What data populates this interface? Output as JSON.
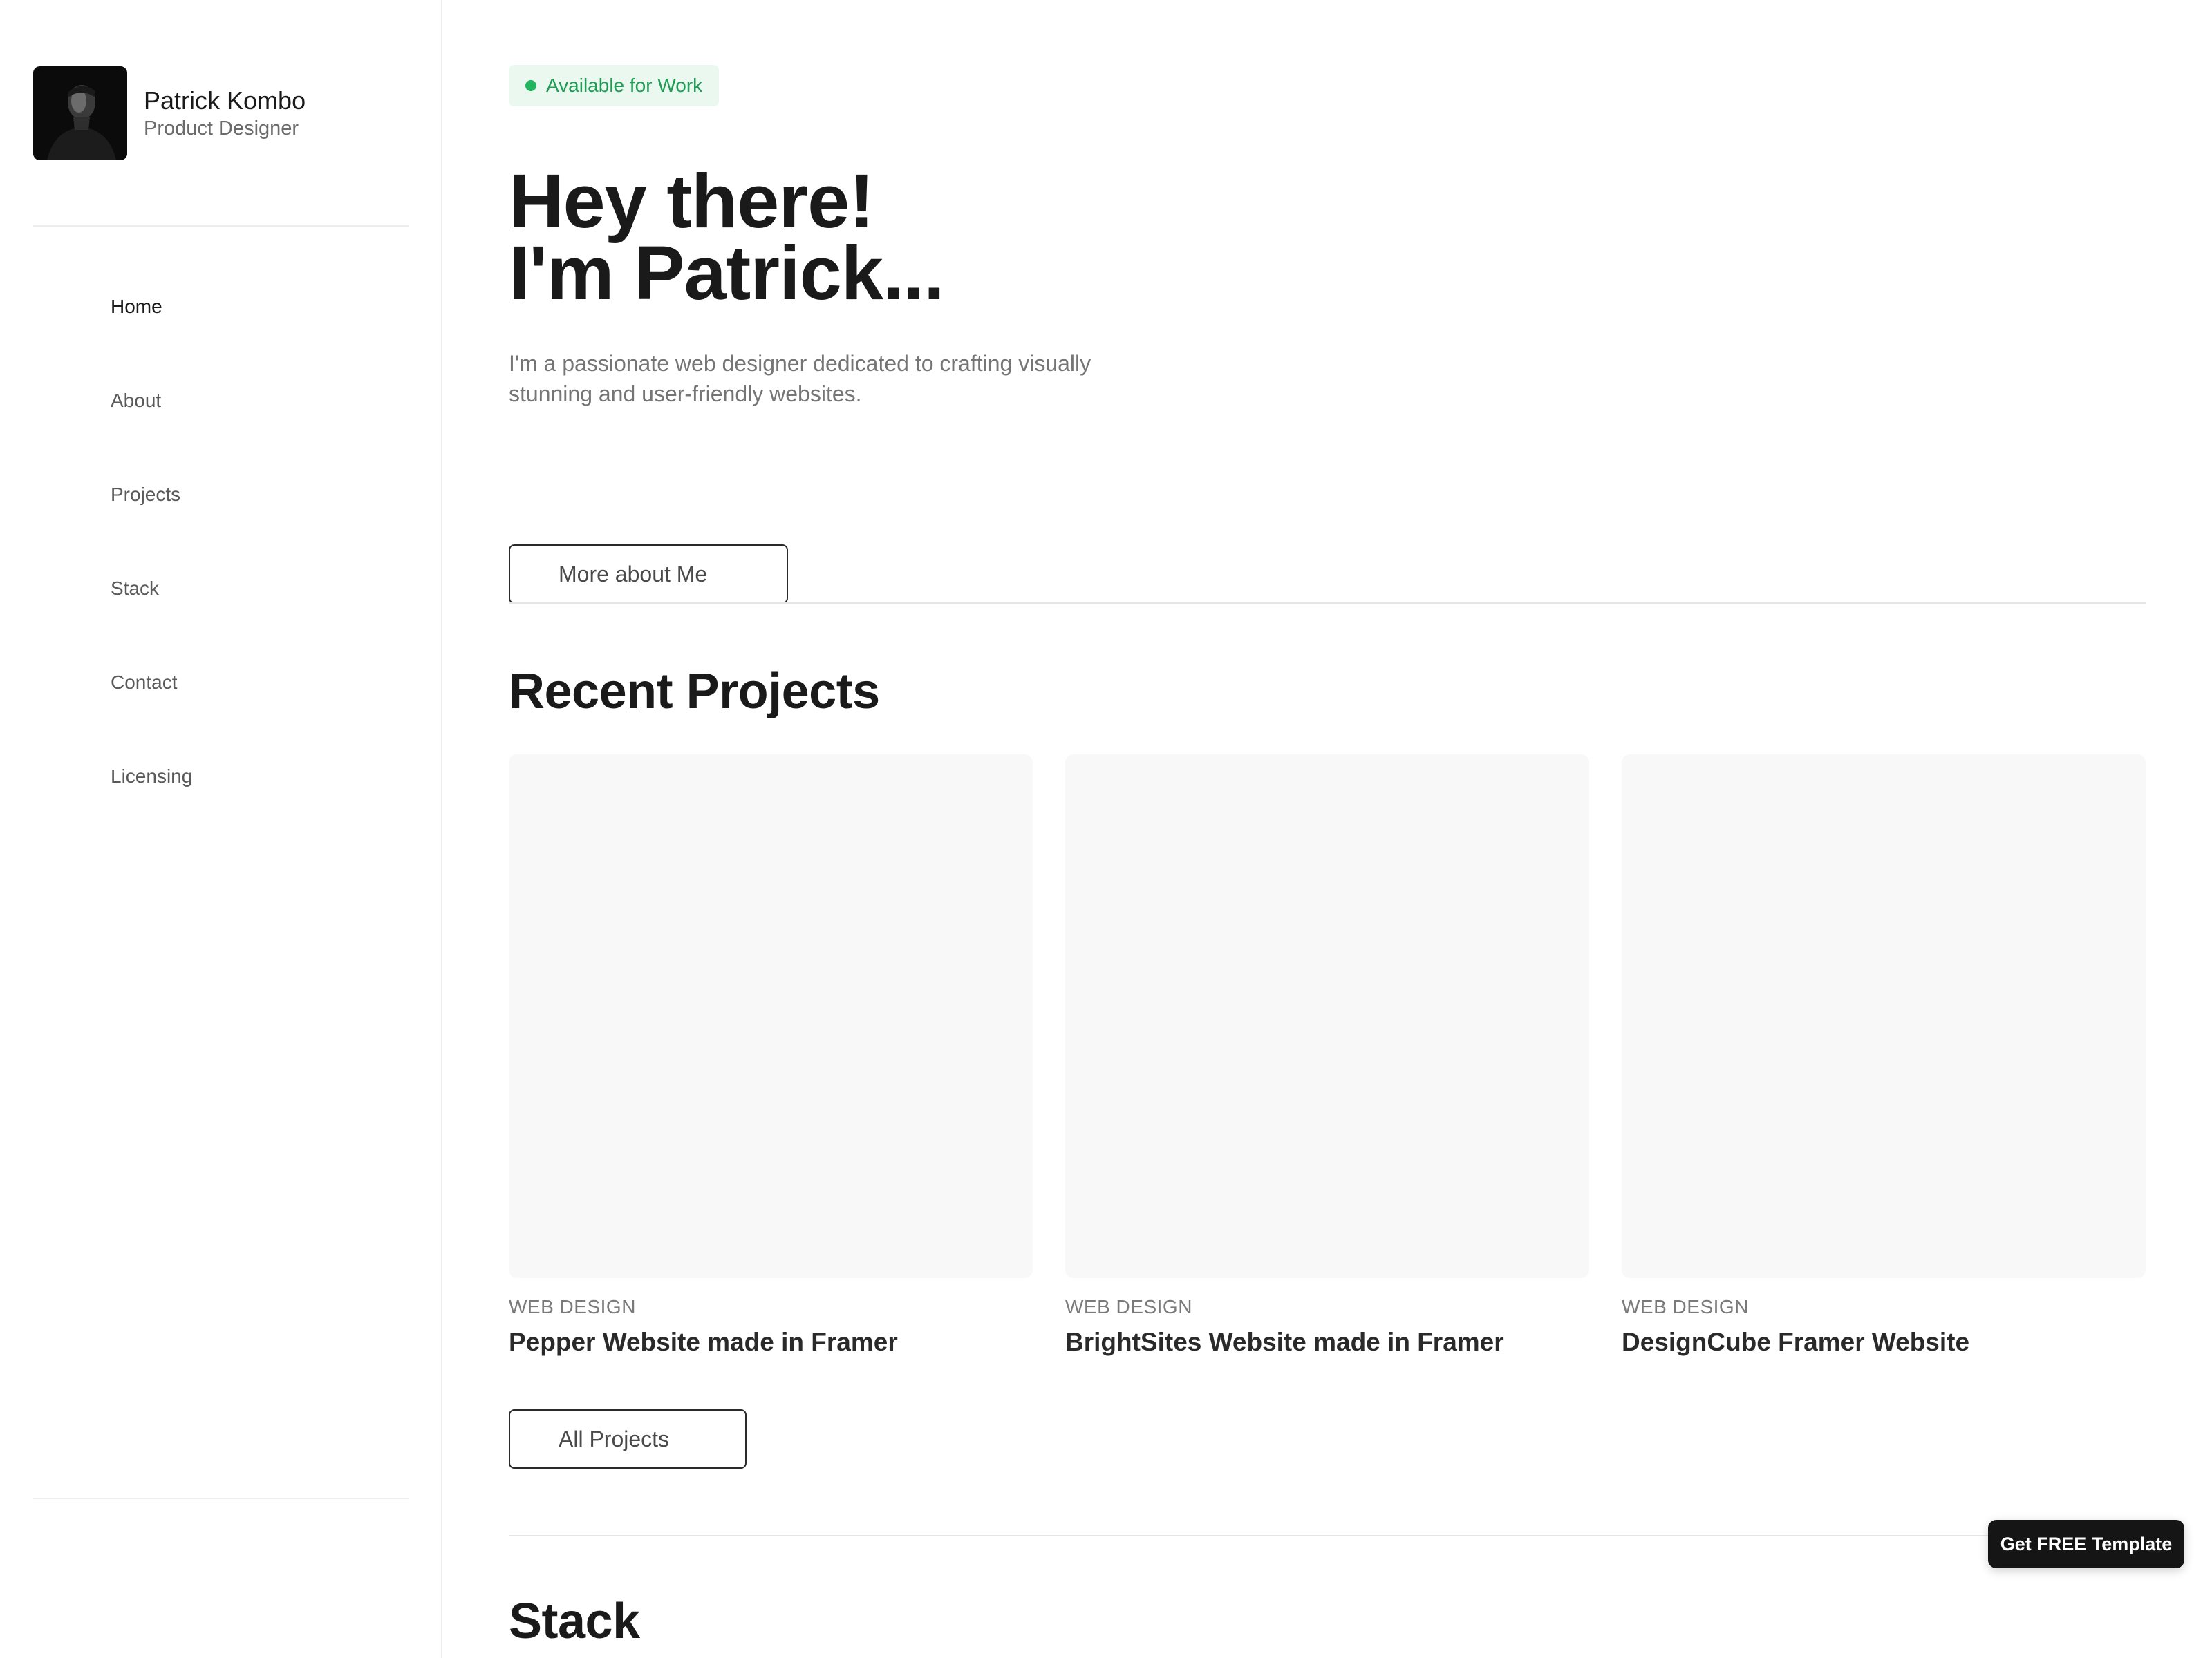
{
  "profile": {
    "name": "Patrick Kombo",
    "role": "Product Designer"
  },
  "nav": {
    "items": [
      {
        "label": "Home",
        "active": true
      },
      {
        "label": "About",
        "active": false
      },
      {
        "label": "Projects",
        "active": false
      },
      {
        "label": "Stack",
        "active": false
      },
      {
        "label": "Contact",
        "active": false
      },
      {
        "label": "Licensing",
        "active": false
      }
    ]
  },
  "hero": {
    "badge": "Available for Work",
    "title_line1": "Hey there!",
    "title_line2": "I'm Patrick...",
    "description": "I'm  a passionate web designer dedicated to crafting visually stunning and user-friendly websites.",
    "more_button": "More about Me"
  },
  "projects": {
    "heading": "Recent Projects",
    "items": [
      {
        "category": "WEB DESIGN",
        "title": "Pepper Website made in Framer"
      },
      {
        "category": "WEB DESIGN",
        "title": "BrightSites Website made in Framer"
      },
      {
        "category": "WEB DESIGN",
        "title": "DesignCube Framer Website"
      }
    ],
    "all_button": "All Projects"
  },
  "stack": {
    "heading": "Stack"
  },
  "cta": {
    "label": "Get FREE Template"
  },
  "colors": {
    "accent_green": "#22b45e",
    "badge_bg": "#eaf8ef",
    "text_dark": "#1a1a1a",
    "cta_bg": "#151515"
  }
}
